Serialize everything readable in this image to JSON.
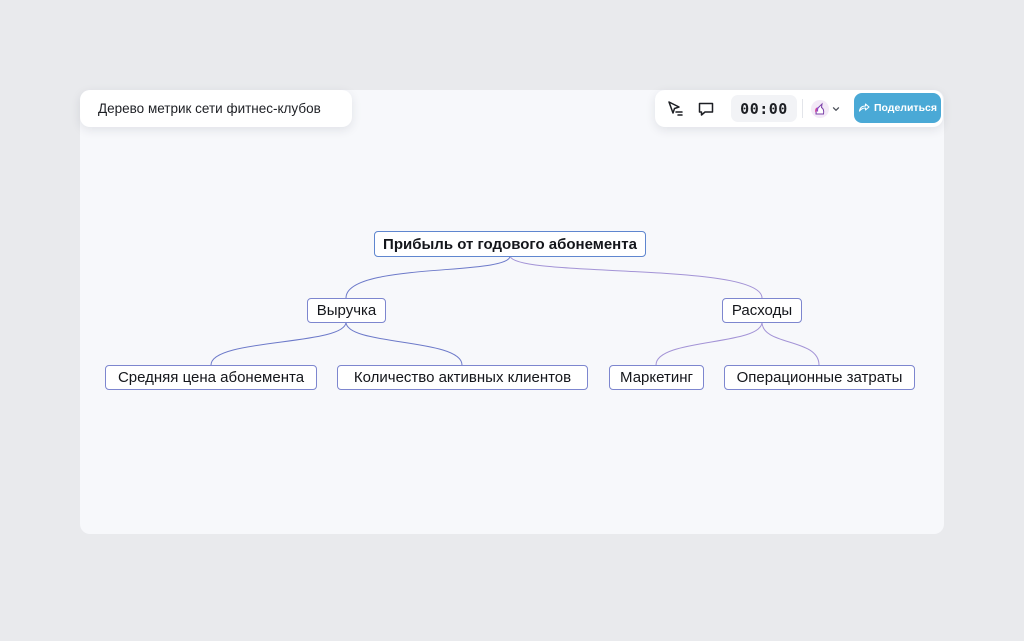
{
  "header": {
    "title": "Дерево метрик сети фитнес-клубов"
  },
  "toolbar": {
    "select_icon": "cursor-select-icon",
    "comment_icon": "comment-bubble-icon",
    "timer": "00:00",
    "avatar_icon": "unicorn-avatar-icon",
    "share_label": "Поделиться",
    "share_color": "#4aa9d6"
  },
  "tree": {
    "root": "Прибыль от годового абонемента",
    "revenue": "Выручка",
    "costs": "Расходы",
    "avg_price": "Средняя цена абонемента",
    "active_clients": "Количество активных клиентов",
    "marketing": "Маркетинг",
    "opex": "Операционные затраты"
  },
  "colors": {
    "node_border": "#7d86cf",
    "edge_left": "#6c79c9",
    "edge_right": "#a393d6"
  }
}
